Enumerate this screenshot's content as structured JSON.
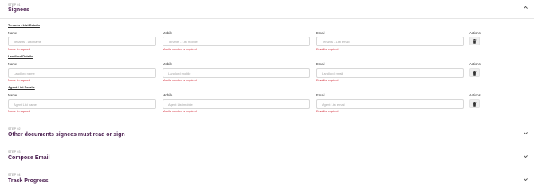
{
  "step1": {
    "label": "STEP 01",
    "title": "Signees",
    "sections": [
      {
        "title": "Tenants - List Details",
        "name_label": "Name",
        "mobile_label": "Mobile",
        "email_label": "Email",
        "actions_label": "Actions",
        "name_placeholder": "Tenants - List name",
        "mobile_placeholder": "Tenants - List mobile",
        "email_placeholder": "Tenants - List email",
        "name_error": "Name is required",
        "mobile_error": "Mobile number is required",
        "email_error": "Email is required"
      },
      {
        "title": "Landlord Details",
        "name_label": "Name",
        "mobile_label": "Mobile",
        "email_label": "Email",
        "actions_label": "Actions",
        "name_placeholder": "Landlord name",
        "mobile_placeholder": "Landlord mobile",
        "email_placeholder": "Landlord email",
        "name_error": "Name is required",
        "mobile_error": "Mobile number is required",
        "email_error": "Email is required"
      },
      {
        "title": "Agent List Details",
        "name_label": "Name",
        "mobile_label": "Mobile",
        "email_label": "Email",
        "actions_label": "Actions",
        "name_placeholder": "Agent List name",
        "mobile_placeholder": "Agent List mobile",
        "email_placeholder": "Agent List email",
        "name_error": "Name is required",
        "mobile_error": "Mobile number is required",
        "email_error": "Email is required"
      }
    ]
  },
  "step2": {
    "label": "STEP 02",
    "title": "Other documents signees must read or sign"
  },
  "step3": {
    "label": "STEP 03",
    "title": "Compose Email"
  },
  "step4": {
    "label": "STEP 04",
    "title": "Track Progress"
  },
  "icons": {
    "expanded": "chevron-up-icon",
    "collapsed": "chevron-down-icon",
    "delete": "trash-icon"
  },
  "colors": {
    "title": "#4a1d4f",
    "error": "#d0202e"
  }
}
